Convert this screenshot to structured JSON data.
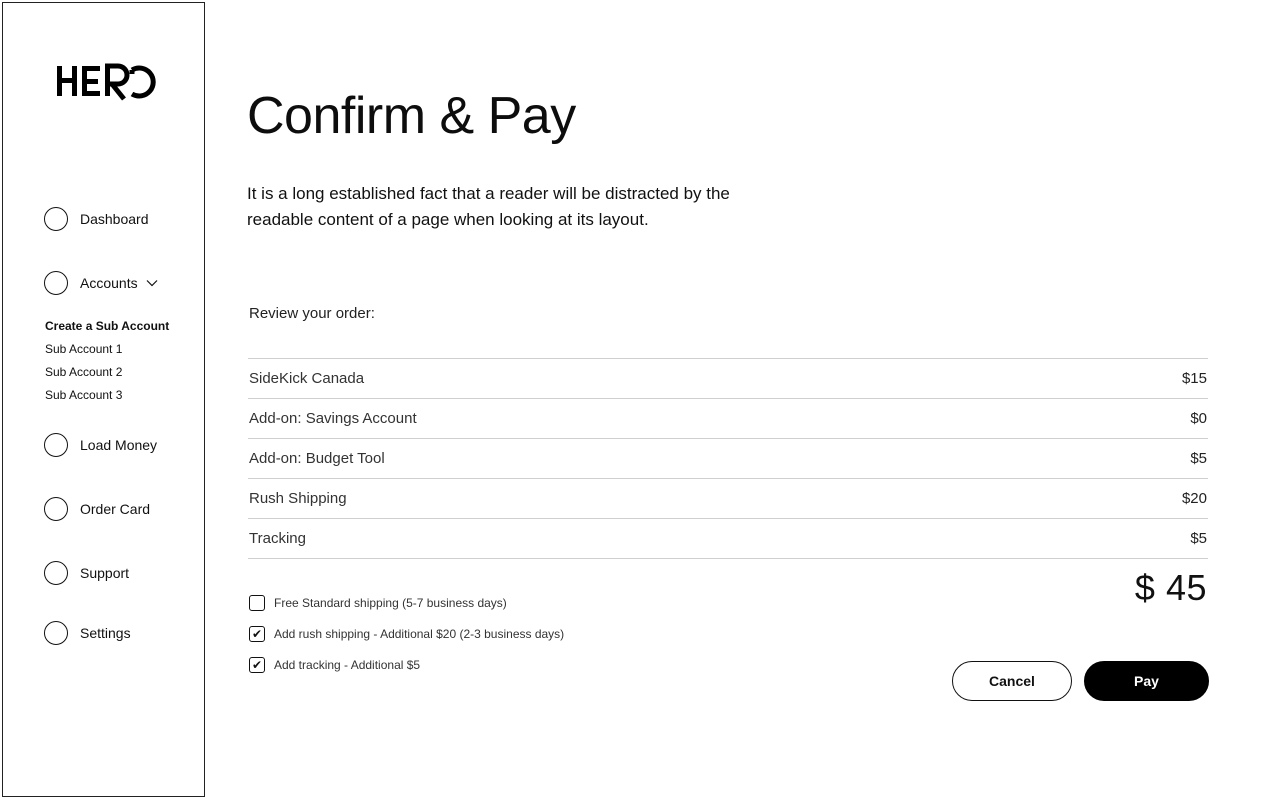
{
  "brand": {
    "logo_text": "HERO"
  },
  "sidebar": {
    "items": [
      {
        "label": "Dashboard"
      },
      {
        "label": "Accounts"
      },
      {
        "label": "Load Money"
      },
      {
        "label": "Order Card"
      },
      {
        "label": "Support"
      },
      {
        "label": "Settings"
      }
    ],
    "sub_items": [
      {
        "label": "Create a Sub Account"
      },
      {
        "label": "Sub Account 1"
      },
      {
        "label": "Sub Account 2"
      },
      {
        "label": "Sub Account 3"
      }
    ]
  },
  "main": {
    "title": "Confirm & Pay",
    "description": "It is a long established fact that a reader will be distracted by the readable content of a page when looking at its layout.",
    "review_label": "Review your order:",
    "order_items": [
      {
        "name": "SideKick Canada",
        "price": "$15"
      },
      {
        "name": "Add-on: Savings Account",
        "price": "$0"
      },
      {
        "name": "Add-on: Budget Tool",
        "price": "$5"
      },
      {
        "name": "Rush Shipping",
        "price": "$20"
      },
      {
        "name": "Tracking",
        "price": "$5"
      }
    ],
    "options": [
      {
        "label": "Free Standard shipping (5-7 business days)",
        "checked": false
      },
      {
        "label": "Add rush shipping - Additional $20 (2-3 business days)",
        "checked": true
      },
      {
        "label": "Add tracking - Additional $5",
        "checked": true
      }
    ],
    "total": "$ 45",
    "cancel_label": "Cancel",
    "pay_label": "Pay"
  },
  "colors": {
    "accent": "#000000",
    "divider": "#cfcfcf"
  }
}
